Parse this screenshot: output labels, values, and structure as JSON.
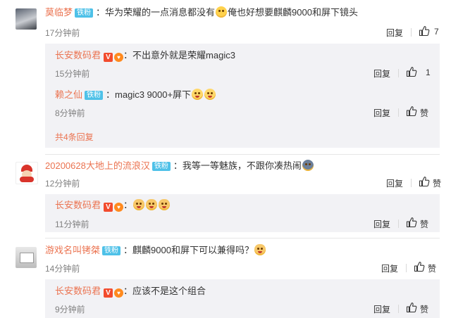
{
  "comments": [
    {
      "user": "莫临梦",
      "badge": "铁粉",
      "text_a": "华为荣耀的一点消息都没有",
      "text_b": "俺也好想要麒麟9000和屏下镜头",
      "time": "17分钟前",
      "reply_label": "回复",
      "likes": "7",
      "replies": [
        {
          "user": "长安数码君",
          "text": "不出意外就是荣耀magic3",
          "time": "15分钟前",
          "reply_label": "回复",
          "likes": "1"
        },
        {
          "user": "赖之仙",
          "badge": "铁粉",
          "text": "magic3   9000+屏下",
          "time": "8分钟前",
          "reply_label": "回复",
          "like_label": "赞"
        }
      ],
      "more_replies": "共4条回复"
    },
    {
      "user": "20200628大地上的流浪汉",
      "badge": "铁粉",
      "text": "我等一等魅族，不跟你凑热闹",
      "time": "12分钟前",
      "reply_label": "回复",
      "like_label": "赞",
      "replies": [
        {
          "user": "长安数码君",
          "time": "11分钟前",
          "reply_label": "回复",
          "like_label": "赞"
        }
      ]
    },
    {
      "user": "游戏名叫铐桀",
      "badge": "铁粉",
      "text": "麒麟9000和屏下可以兼得吗？",
      "time": "14分钟前",
      "reply_label": "回复",
      "like_label": "赞",
      "replies": [
        {
          "user": "长安数码君",
          "text": "应该不是这个组合",
          "time": "9分钟前",
          "reply_label": "回复",
          "like_label": "赞"
        }
      ]
    }
  ],
  "colors": {
    "username": "#eb7350",
    "fan_badge": "#4ec1e8",
    "verified": "#f24c2e",
    "reply_bg": "#f2f2f5"
  },
  "icons": {
    "like": "thumbs-up-icon",
    "verified": "verified-v-icon",
    "level": "level-badge-icon"
  }
}
